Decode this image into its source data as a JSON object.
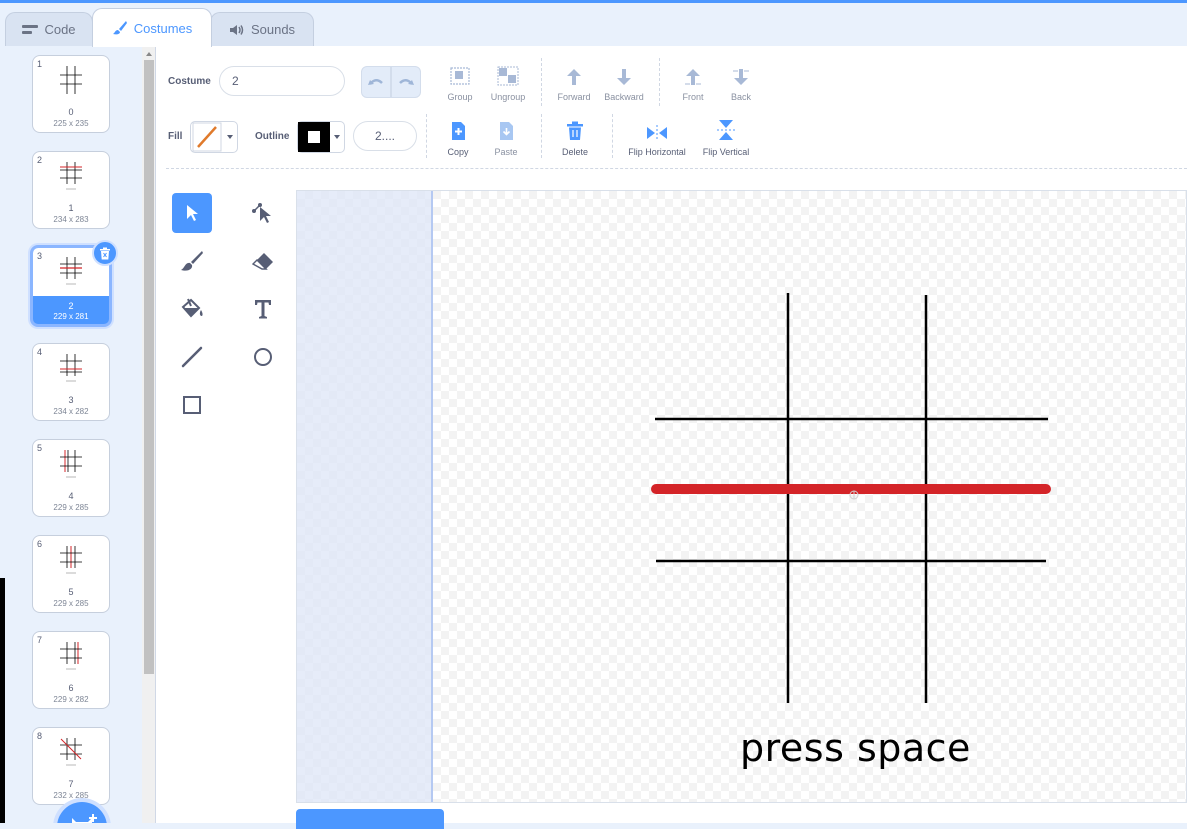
{
  "tabs": {
    "code": "Code",
    "costumes": "Costumes",
    "sounds": "Sounds",
    "active": "Costumes"
  },
  "costumes": [
    {
      "number": "1",
      "name": "0",
      "size": "225 x 235"
    },
    {
      "number": "2",
      "name": "1",
      "size": "234 x 283"
    },
    {
      "number": "3",
      "name": "2",
      "size": "229 x 281"
    },
    {
      "number": "4",
      "name": "3",
      "size": "234 x 282"
    },
    {
      "number": "5",
      "name": "4",
      "size": "229 x 285"
    },
    {
      "number": "6",
      "name": "5",
      "size": "229 x 285"
    },
    {
      "number": "7",
      "name": "6",
      "size": "229 x 282"
    },
    {
      "number": "8",
      "name": "7",
      "size": "232 x 285"
    }
  ],
  "selected_costume_index": 2,
  "toolbar": {
    "costume_label": "Costume",
    "costume_name": "2",
    "group": "Group",
    "ungroup": "Ungroup",
    "forward": "Forward",
    "backward": "Backward",
    "front": "Front",
    "back": "Back",
    "fill_label": "Fill",
    "outline_label": "Outline",
    "outline_width": "2....",
    "copy": "Copy",
    "paste": "Paste",
    "delete": "Delete",
    "flip_horizontal": "Flip Horizontal",
    "flip_vertical": "Flip Vertical"
  },
  "canvas": {
    "text": "press space",
    "line_color": "#000000",
    "highlight_color": "#d42428"
  },
  "colors": {
    "accent": "#4c97ff",
    "fill_swatch": "#e07a2b",
    "outline_swatch": "#000000"
  }
}
